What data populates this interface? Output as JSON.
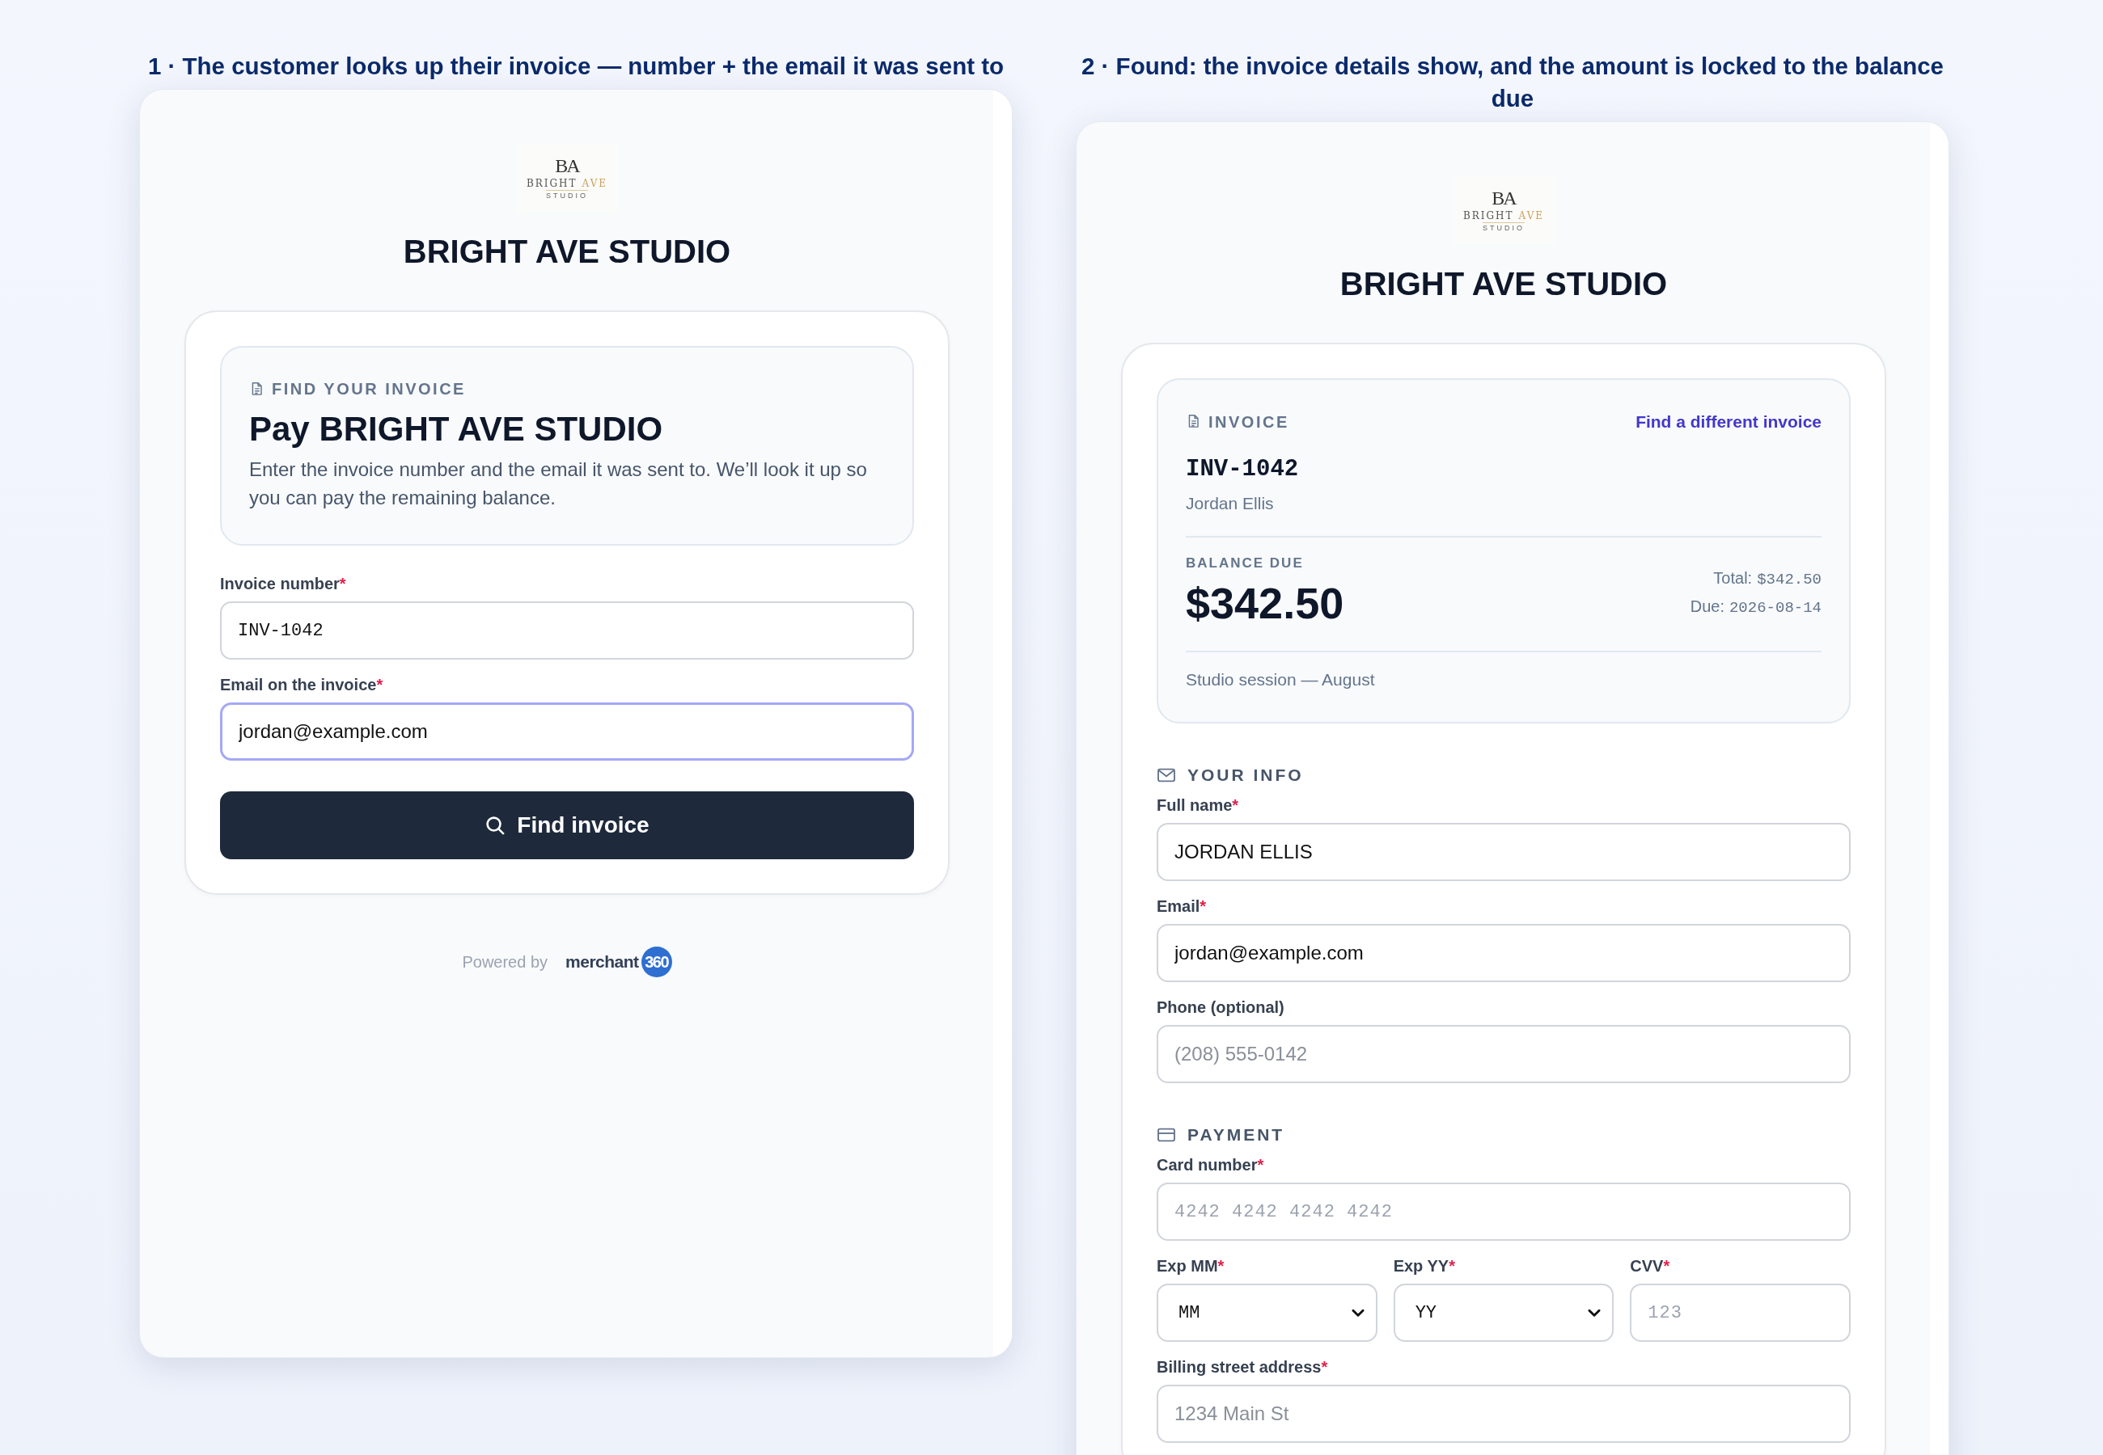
{
  "required_mark": "*",
  "panels": [
    {
      "kind": "lookup",
      "caption": "1 · The customer looks up their invoice — number + the email it was sent to",
      "logo": {
        "monogram": "BA",
        "wordmark": "BRIGHT",
        "accent": "AVE",
        "tagline": "STUDIO"
      },
      "business_name": "BRIGHT AVE STUDIO",
      "intro": {
        "eyebrow": "FIND YOUR INVOICE",
        "title": "Pay BRIGHT AVE STUDIO",
        "text": "Enter the invoice number and the email it was sent to. We’ll look it up so you can pay the remaining balance."
      },
      "sections": [
        {
          "rows": [
            [
              {
                "kind": "mono",
                "label": "Invoice number",
                "required": true,
                "value": "INV-1042",
                "focused": false
              }
            ],
            [
              {
                "kind": "text",
                "label": "Email on the invoice",
                "required": true,
                "value": "jordan@example.com",
                "focused": true
              }
            ]
          ]
        }
      ],
      "button": {
        "label": "Find invoice"
      },
      "powered_by": {
        "label": "Powered by",
        "brand": "merchant",
        "badge": "360"
      }
    },
    {
      "kind": "payment",
      "caption": "2 · Found: the invoice details show, and the amount is locked to the balance due",
      "logo": {
        "monogram": "BA",
        "wordmark": "BRIGHT",
        "accent": "AVE",
        "tagline": "STUDIO"
      },
      "business_name": "BRIGHT AVE STUDIO",
      "invoice": {
        "eyebrow": "INVOICE",
        "link": "Find a different invoice",
        "number": "INV-1042",
        "customer": "Jordan Ellis",
        "balance_label": "BALANCE DUE",
        "balance": "$342.50",
        "total_label": "Total:",
        "total": "$342.50",
        "due_label": "Due:",
        "due": "2026-08-14",
        "description": "Studio session — August"
      },
      "sections": [
        {
          "kind": "info",
          "title": "YOUR INFO",
          "rows": [
            [
              {
                "kind": "text",
                "label": "Full name",
                "required": true,
                "value": "JORDAN ELLIS",
                "focused": false
              }
            ],
            [
              {
                "kind": "text",
                "label": "Email",
                "required": true,
                "value": "jordan@example.com",
                "focused": false
              }
            ],
            [
              {
                "kind": "text",
                "label": "Phone (optional)",
                "required": false,
                "placeholder": "(208) 555-0142",
                "focused": false
              }
            ]
          ]
        },
        {
          "kind": "payment",
          "title": "PAYMENT",
          "rows": [
            [
              {
                "kind": "mono",
                "label": "Card number",
                "required": true,
                "placeholder": "4242 4242 4242 4242",
                "focused": false
              }
            ],
            [
              {
                "kind": "select",
                "label": "Exp MM",
                "required": true,
                "value": "MM",
                "focused": false
              },
              {
                "kind": "select",
                "label": "Exp YY",
                "required": true,
                "value": "YY",
                "focused": false
              },
              {
                "kind": "mono",
                "label": "CVV",
                "required": true,
                "placeholder": "123",
                "focused": false
              }
            ],
            [
              {
                "kind": "text",
                "label": "Billing street address",
                "required": true,
                "placeholder": "1234 Main St",
                "focused": false
              }
            ]
          ]
        }
      ]
    }
  ]
}
